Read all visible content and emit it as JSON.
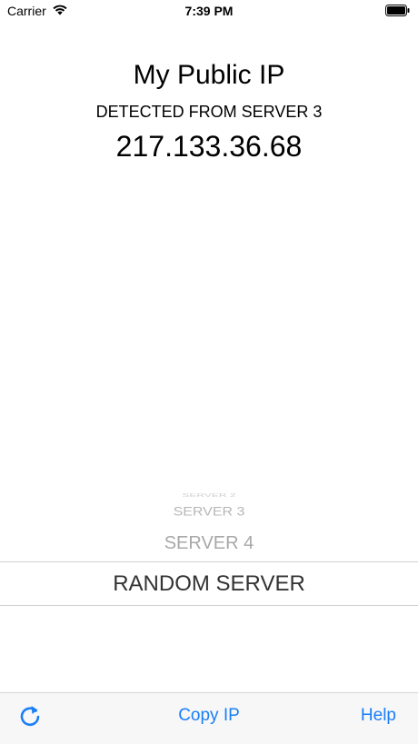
{
  "status_bar": {
    "carrier": "Carrier",
    "time": "7:39 PM",
    "wifi_icon": "wifi-icon",
    "battery_icon": "battery-icon"
  },
  "header": {
    "title": "My Public IP",
    "detected_from": "DETECTED FROM SERVER 3",
    "ip": "217.133.36.68"
  },
  "picker": {
    "items_above": [
      "SERVER 2",
      "SERVER 3",
      "SERVER 4"
    ],
    "selected": "RANDOM SERVER"
  },
  "toolbar": {
    "refresh_icon": "refresh-icon",
    "copy_label": "Copy IP",
    "help_label": "Help"
  },
  "colors": {
    "accent": "#1a7ef7",
    "toolbar_bg": "#f7f7f7",
    "picker_text": "#a8a8a8"
  }
}
